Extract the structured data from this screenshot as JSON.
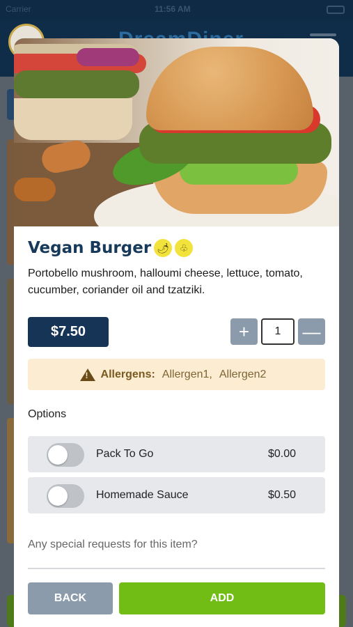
{
  "status_bar": {
    "carrier": "Carrier",
    "time": "11:56 AM"
  },
  "background_app": {
    "brand": "DreamDiner"
  },
  "item": {
    "name": "Vegan Burger",
    "badges": [
      {
        "icon": "chili-pepper-icon",
        "glyph": "🌶"
      },
      {
        "icon": "acorn-icon",
        "glyph": "♧"
      }
    ],
    "description": "Portobello mushroom, halloumi cheese, lettuce, tomato, cucumber, coriander oil and tzatziki.",
    "price": "$7.50",
    "quantity": "1",
    "plus_label": "+",
    "minus_label": "—"
  },
  "allergens": {
    "label": "Allergens:",
    "items": [
      "Allergen1,",
      "Allergen2"
    ]
  },
  "options": {
    "title": "Options",
    "items": [
      {
        "name": "Pack To Go",
        "price": "$0.00",
        "enabled": false
      },
      {
        "name": "Homemade Sauce",
        "price": "$0.50",
        "enabled": false
      }
    ]
  },
  "special_requests": {
    "placeholder": "Any special requests for this item?"
  },
  "footer": {
    "back_label": "BACK",
    "add_label": "ADD"
  },
  "colors": {
    "primary_navy": "#163556",
    "add_green": "#72bd15",
    "neutral_button": "#8b9bab",
    "allergen_bg": "#fbecd2"
  }
}
